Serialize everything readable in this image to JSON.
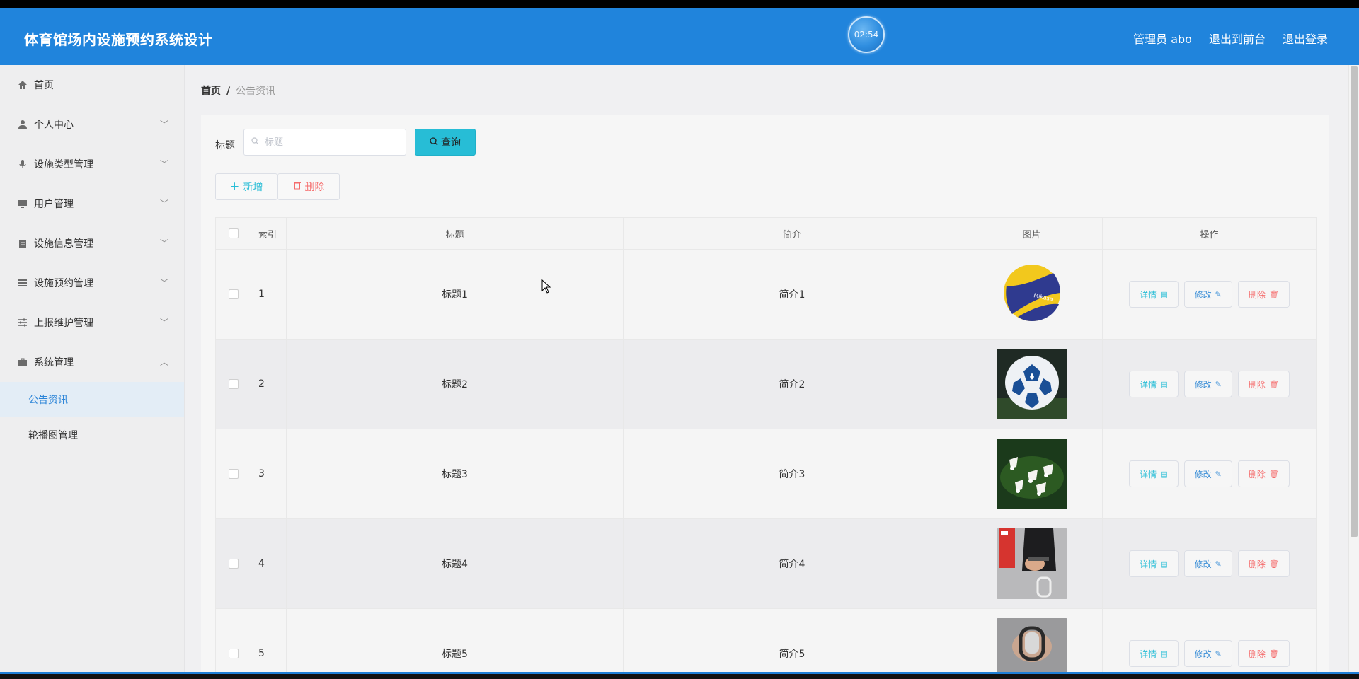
{
  "header": {
    "app_title": "体育馆场内设施预约系统设计",
    "clock": "02:54",
    "user_label": "管理员 abo",
    "to_front": "退出到前台",
    "logout": "退出登录",
    "brand_color": "#2084dc"
  },
  "sidebar": {
    "items": [
      {
        "label": "首页",
        "icon": "home-icon"
      },
      {
        "label": "个人中心",
        "icon": "user-icon"
      },
      {
        "label": "设施类型管理",
        "icon": "microphone-icon"
      },
      {
        "label": "用户管理",
        "icon": "monitor-icon"
      },
      {
        "label": "设施信息管理",
        "icon": "clipboard-icon"
      },
      {
        "label": "设施预约管理",
        "icon": "list-icon"
      },
      {
        "label": "上报维护管理",
        "icon": "sliders-icon"
      },
      {
        "label": "系统管理",
        "icon": "briefcase-icon"
      }
    ],
    "sub_items": [
      {
        "label": "公告资讯",
        "active": true
      },
      {
        "label": "轮播图管理",
        "active": false
      }
    ]
  },
  "breadcrumb": {
    "home": "首页",
    "separator": "/",
    "current": "公告资讯"
  },
  "search": {
    "label": "标题",
    "placeholder": "标题",
    "button": "查询"
  },
  "actions": {
    "add": "新增",
    "delete": "删除"
  },
  "table": {
    "headers": {
      "index": "索引",
      "title": "标题",
      "brief": "简介",
      "image": "图片",
      "ops": "操作"
    },
    "op_labels": {
      "detail": "详情",
      "edit": "修改",
      "remove": "删除"
    },
    "rows": [
      {
        "index": "1",
        "title": "标题1",
        "brief": "简介1",
        "image": "volleyball"
      },
      {
        "index": "2",
        "title": "标题2",
        "brief": "简介2",
        "image": "soccer-ball"
      },
      {
        "index": "3",
        "title": "标题3",
        "brief": "简介3",
        "image": "shuttlecocks"
      },
      {
        "index": "4",
        "title": "标题4",
        "brief": "简介4",
        "image": "hand-grip-trainer"
      },
      {
        "index": "5",
        "title": "标题5",
        "brief": "简介5",
        "image": "grip-strengthener"
      }
    ]
  }
}
